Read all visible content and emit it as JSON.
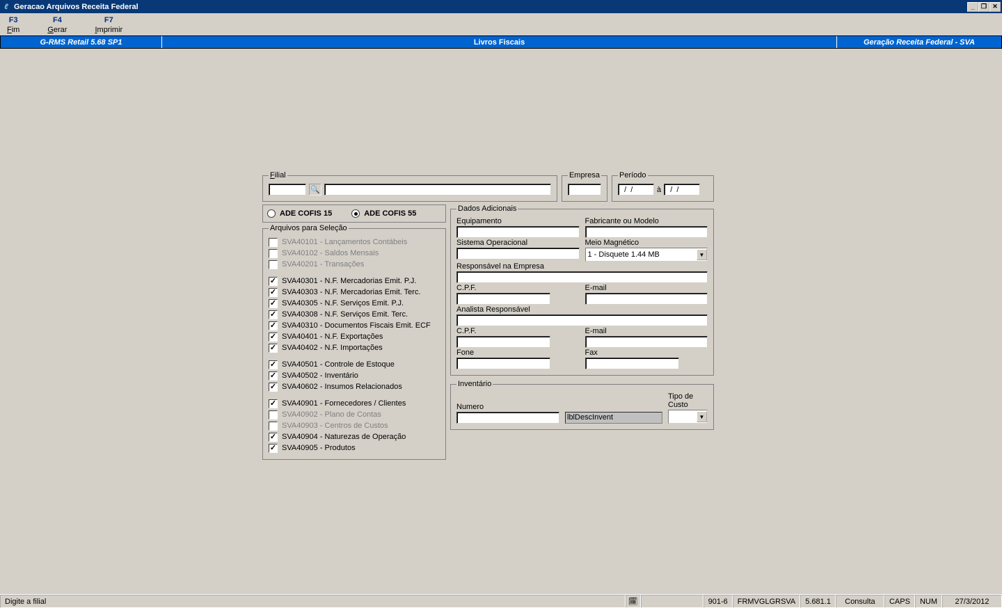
{
  "title": "Geracao Arquivos Receita Federal",
  "menu": {
    "f3_key": "F3",
    "f3_label": "Fim",
    "f4_key": "F4",
    "f4_label": "Gerar",
    "f7_key": "F7",
    "f7_label": "Imprimir"
  },
  "header": {
    "left": "G-RMS Retail 5.68 SP1",
    "center": "Livros Fiscais",
    "right": "Geração Receita Federal - SVA"
  },
  "groups": {
    "filial": "Filial",
    "empresa": "Empresa",
    "periodo": "Período",
    "arquivos": "Arquivos para Seleção",
    "dados": "Dados Adicionais",
    "inventario": "Inventário"
  },
  "periodo": {
    "from": "  /  /",
    "to": "  /  /",
    "a": "à"
  },
  "radios": {
    "r1": "ADE COFIS 15",
    "r2": "ADE COFIS 55"
  },
  "checks": [
    {
      "label": "SVA40101 - Lançamentos Contábeis",
      "checked": false,
      "disabled": true
    },
    {
      "label": "SVA40102 - Saldos Mensais",
      "checked": false,
      "disabled": true
    },
    {
      "label": "SVA40201 - Transações",
      "checked": false,
      "disabled": true
    },
    {
      "gap": true
    },
    {
      "label": "SVA40301 - N.F. Mercadorias Emit. P.J.",
      "checked": true,
      "disabled": false
    },
    {
      "label": "SVA40303 - N.F. Mercadorias Emit. Terc.",
      "checked": true,
      "disabled": false
    },
    {
      "label": "SVA40305 - N.F. Serviços Emit. P.J.",
      "checked": true,
      "disabled": false
    },
    {
      "label": "SVA40308 - N.F. Serviços Emit. Terc.",
      "checked": true,
      "disabled": false
    },
    {
      "label": "SVA40310 - Documentos Fiscais Emit. ECF",
      "checked": true,
      "disabled": false
    },
    {
      "label": "SVA40401 - N.F. Exportações",
      "checked": true,
      "disabled": false
    },
    {
      "label": "SVA40402 - N.F. Importações",
      "checked": true,
      "disabled": false
    },
    {
      "gap": true
    },
    {
      "label": "SVA40501 - Controle de Estoque",
      "checked": true,
      "disabled": false
    },
    {
      "label": "SVA40502 - Inventário",
      "checked": true,
      "disabled": false
    },
    {
      "label": "SVA40602 - Insumos Relacionados",
      "checked": true,
      "disabled": false
    },
    {
      "gap": true
    },
    {
      "label": "SVA40901 - Fornecedores / Clientes",
      "checked": true,
      "disabled": false
    },
    {
      "label": "SVA40902 - Plano de Contas",
      "checked": false,
      "disabled": true
    },
    {
      "label": "SVA40903 - Centros de Custos",
      "checked": false,
      "disabled": true
    },
    {
      "label": "SVA40904 - Naturezas de Operação",
      "checked": true,
      "disabled": false
    },
    {
      "label": "SVA40905 - Produtos",
      "checked": true,
      "disabled": false
    }
  ],
  "dados": {
    "equipamento": "Equipamento",
    "fabricante": "Fabricante ou Modelo",
    "so": "Sistema Operacional",
    "meio": "Meio Magnético",
    "meio_val": "1 - Disquete 1.44 MB",
    "resp_emp": "Responsável na Empresa",
    "cpf": "C.P.F.",
    "email": "E-mail",
    "analista": "Analista Responsável",
    "fone": "Fone",
    "fax": "Fax"
  },
  "inventario": {
    "numero": "Numero",
    "desc": "lblDescInvent",
    "tipo": "Tipo de Custo"
  },
  "status": {
    "hint": "Digite a filial",
    "code": "901-6",
    "form": "FRMVGLGRSVA",
    "ver": "5.681.1",
    "mode": "Consulta",
    "caps": "CAPS",
    "num": "NUM",
    "date": "27/3/2012"
  }
}
